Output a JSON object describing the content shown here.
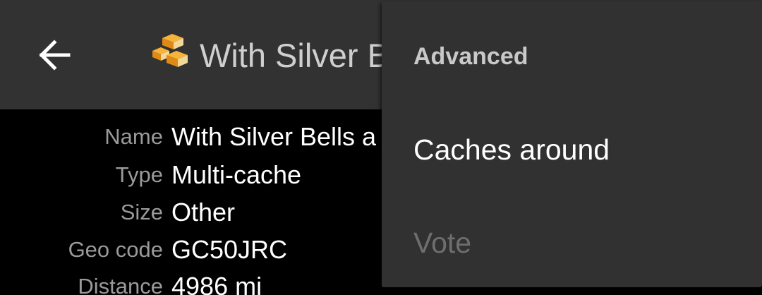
{
  "appbar": {
    "title": "With Silver Bells and Cockle Shells",
    "back_icon": "arrow-left-icon",
    "cache_icon": "multi-cache-icon"
  },
  "details": [
    {
      "label": "Name",
      "value": "With Silver Bells a"
    },
    {
      "label": "Type",
      "value": "Multi-cache"
    },
    {
      "label": "Size",
      "value": "Other"
    },
    {
      "label": "Geo code",
      "value": "GC50JRC"
    },
    {
      "label": "Distance",
      "value": "4986 mi"
    }
  ],
  "menu": {
    "header": "Advanced",
    "items": [
      {
        "label": "Caches around",
        "enabled": true
      },
      {
        "label": "Vote",
        "enabled": false
      }
    ]
  },
  "colors": {
    "appbar_bg": "#323232",
    "menu_bg": "#313131",
    "content_bg": "#000000",
    "label_text": "#9a9a9a",
    "value_text": "#ffffff",
    "disabled_text": "#6e6e6e"
  }
}
